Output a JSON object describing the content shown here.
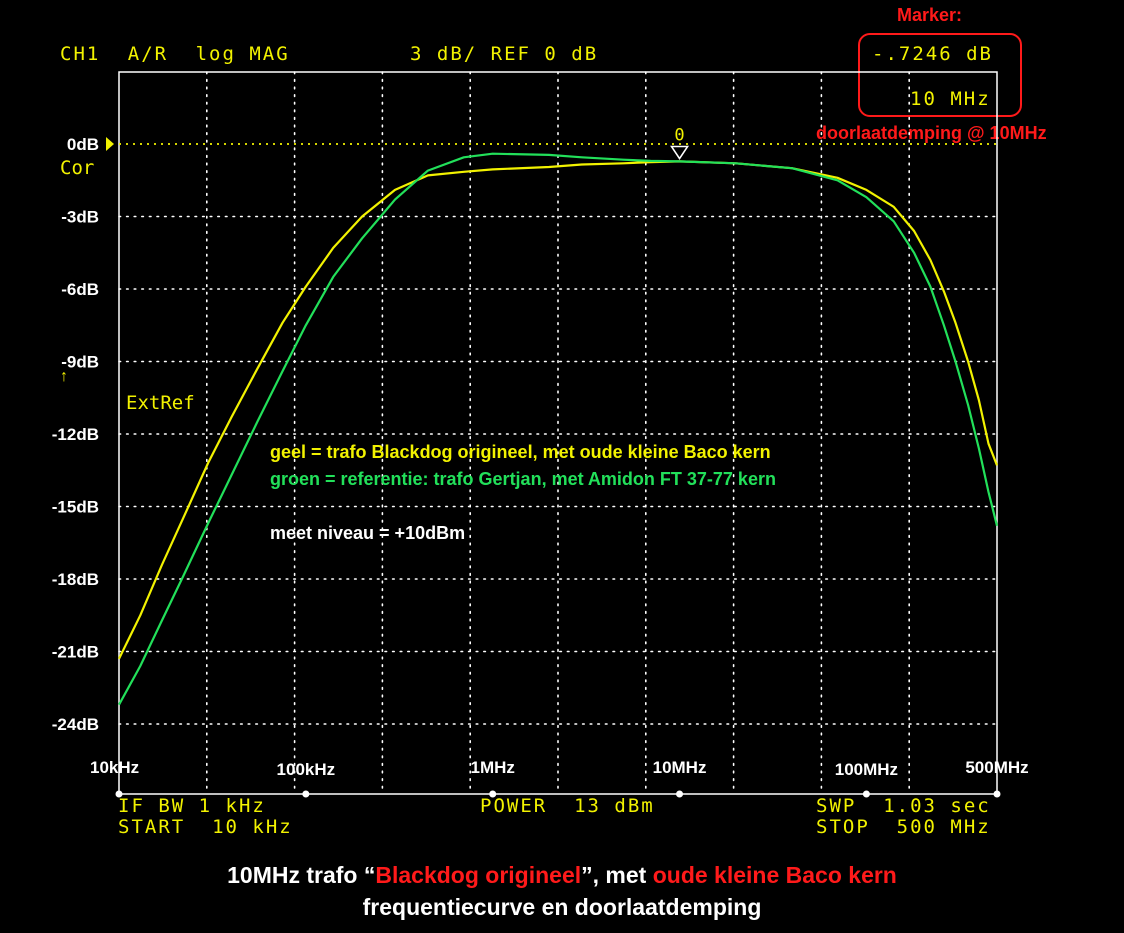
{
  "header": {
    "channel": "CH1",
    "measurement": "A/R",
    "format": "log MAG",
    "scale": "3 dB/ REF 0 dB",
    "marker_value": "-.7246 dB",
    "marker_freq": "10 MHz"
  },
  "annotations": {
    "marker_title": "Marker:",
    "marker_caption": "doorlaatdemping @ 10MHz",
    "ref_marker": "0dB",
    "cor": "Cor",
    "extref": "ExtRef",
    "marker_number": "0",
    "legend_geel": "geel   = trafo Blackdog origineel, met oude kleine Baco kern",
    "legend_groen": "groen = referentie: trafo Gertjan, met Amidon FT 37-77 kern",
    "meet_niveau": "meet niveau = +10dBm"
  },
  "footer": {
    "if_bw": "IF BW 1 kHz",
    "start": "START  10 kHz",
    "power": "POWER  13 dBm",
    "swp": "SWP  1.03 sec",
    "stop": "STOP  500 MHz"
  },
  "caption": {
    "line1_a": "10MHz trafo “",
    "line1_b": "Blackdog origineel",
    "line1_c": "”, met ",
    "line1_d": "oude kleine Baco kern",
    "line2": "frequentiecurve en doorlaatdemping"
  },
  "colors": {
    "background": "#000000",
    "grid": "#ffffff",
    "trace_geel": "#f2f200",
    "trace_groen": "#22e05a",
    "reference_line": "#f2f200",
    "highlight": "#ff1a1a"
  },
  "chart_data": {
    "type": "line",
    "xscale": "log",
    "x_unit": "Hz",
    "xlim": [
      10000,
      500000000
    ],
    "ylim": [
      -24,
      0
    ],
    "y_divisions": [
      0,
      -3,
      -6,
      -9,
      -12,
      -15,
      -18,
      -21,
      -24
    ],
    "y_tick_labels": [
      "0dB",
      "-3dB",
      "-6dB",
      "-9dB",
      "-12dB",
      "-15dB",
      "-18dB",
      "-21dB",
      "-24dB"
    ],
    "x_ticks": [
      10000,
      100000,
      1000000,
      10000000,
      100000000,
      500000000
    ],
    "x_tick_labels": [
      "10kHz",
      "100kHz",
      "1MHz",
      "10MHz",
      "100MHz",
      "500MHz"
    ],
    "grid": true,
    "marker": {
      "x": 10000000,
      "y": -0.7246
    },
    "series": [
      {
        "name": "geel",
        "color": "#f2f200",
        "x": [
          10000,
          13000,
          17000,
          22000,
          30000,
          40000,
          55000,
          75000,
          100000,
          140000,
          200000,
          300000,
          450000,
          700000,
          1000000,
          2000000,
          3000000,
          5000000,
          7000000,
          10000000,
          20000000,
          40000000,
          70000000,
          100000000,
          140000000,
          180000000,
          220000000,
          260000000,
          300000000,
          350000000,
          400000000,
          450000000,
          500000000
        ],
        "y": [
          -21.3,
          -19.5,
          -17.4,
          -15.5,
          -13.2,
          -11.3,
          -9.3,
          -7.4,
          -5.9,
          -4.3,
          -3.0,
          -1.9,
          -1.3,
          -1.15,
          -1.05,
          -0.95,
          -0.85,
          -0.8,
          -0.75,
          -0.72,
          -0.8,
          -1.0,
          -1.4,
          -1.9,
          -2.6,
          -3.6,
          -4.8,
          -6.1,
          -7.4,
          -9.0,
          -10.6,
          -12.4,
          -13.3
        ]
      },
      {
        "name": "groen",
        "color": "#22e05a",
        "x": [
          10000,
          13000,
          17000,
          22000,
          30000,
          40000,
          55000,
          75000,
          100000,
          140000,
          200000,
          300000,
          450000,
          700000,
          1000000,
          2000000,
          3000000,
          5000000,
          7000000,
          10000000,
          20000000,
          40000000,
          70000000,
          100000000,
          140000000,
          180000000,
          220000000,
          260000000,
          300000000,
          350000000,
          400000000,
          450000000,
          500000000
        ],
        "y": [
          -23.2,
          -21.6,
          -19.7,
          -17.9,
          -15.7,
          -13.7,
          -11.5,
          -9.4,
          -7.5,
          -5.5,
          -3.9,
          -2.3,
          -1.1,
          -0.55,
          -0.4,
          -0.45,
          -0.55,
          -0.65,
          -0.7,
          -0.72,
          -0.8,
          -1.0,
          -1.5,
          -2.2,
          -3.2,
          -4.5,
          -5.9,
          -7.5,
          -9.0,
          -10.8,
          -12.6,
          -14.4,
          -15.8
        ]
      }
    ]
  }
}
